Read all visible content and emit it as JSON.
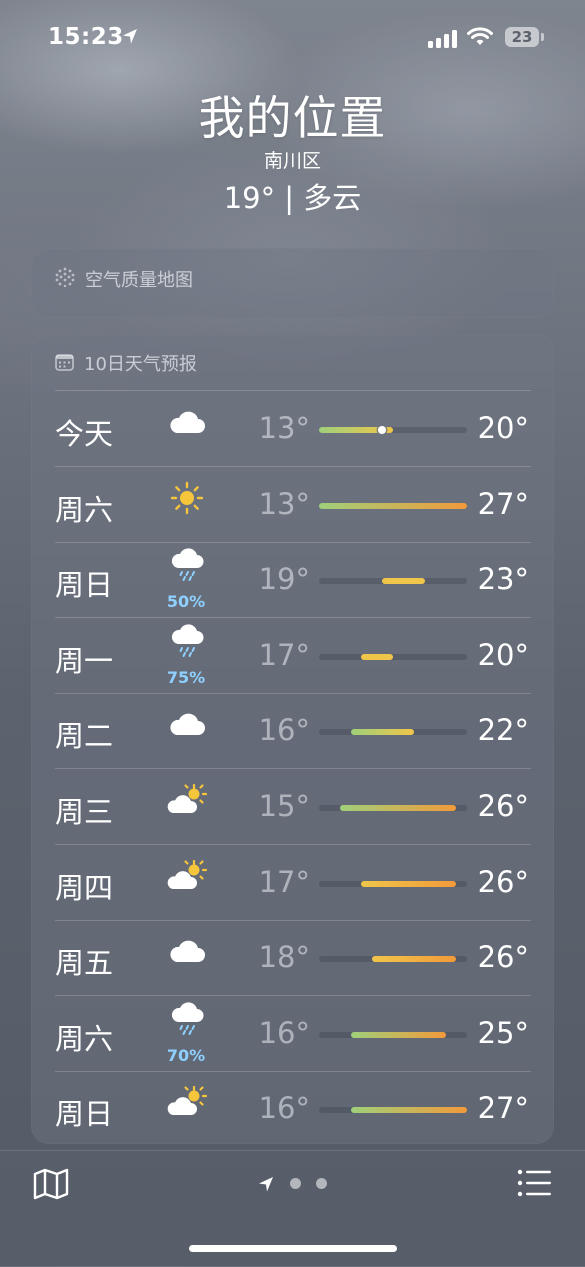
{
  "status_bar": {
    "time": "15:23",
    "battery": "23"
  },
  "header": {
    "location": "我的位置",
    "district": "南川区",
    "current": "19° | 多云"
  },
  "air_quality": {
    "icon": "air-quality-dots-icon",
    "label": "空气质量地图"
  },
  "forecast": {
    "icon": "calendar-icon",
    "title": "10日天气预报",
    "range_min": 13,
    "range_max": 27,
    "current_temp": 19,
    "days": [
      {
        "day": "今天",
        "icon": "cloud-icon",
        "precip": "",
        "low": "13°",
        "high": "20°",
        "low_val": 13,
        "high_val": 20,
        "show_current": true
      },
      {
        "day": "周六",
        "icon": "sun-icon",
        "precip": "",
        "low": "13°",
        "high": "27°",
        "low_val": 13,
        "high_val": 27,
        "show_current": false
      },
      {
        "day": "周日",
        "icon": "cloud-rain-icon",
        "precip": "50%",
        "low": "19°",
        "high": "23°",
        "low_val": 19,
        "high_val": 23,
        "show_current": false
      },
      {
        "day": "周一",
        "icon": "cloud-rain-icon",
        "precip": "75%",
        "low": "17°",
        "high": "20°",
        "low_val": 17,
        "high_val": 20,
        "show_current": false
      },
      {
        "day": "周二",
        "icon": "cloud-icon",
        "precip": "",
        "low": "16°",
        "high": "22°",
        "low_val": 16,
        "high_val": 22,
        "show_current": false
      },
      {
        "day": "周三",
        "icon": "partly-sunny-icon",
        "precip": "",
        "low": "15°",
        "high": "26°",
        "low_val": 15,
        "high_val": 26,
        "show_current": false
      },
      {
        "day": "周四",
        "icon": "partly-sunny-icon",
        "precip": "",
        "low": "17°",
        "high": "26°",
        "low_val": 17,
        "high_val": 26,
        "show_current": false
      },
      {
        "day": "周五",
        "icon": "cloud-icon",
        "precip": "",
        "low": "18°",
        "high": "26°",
        "low_val": 18,
        "high_val": 26,
        "show_current": false
      },
      {
        "day": "周六",
        "icon": "cloud-rain-icon",
        "precip": "70%",
        "low": "16°",
        "high": "25°",
        "low_val": 16,
        "high_val": 25,
        "show_current": false
      },
      {
        "day": "周日",
        "icon": "partly-sunny-icon",
        "precip": "",
        "low": "16°",
        "high": "27°",
        "low_val": 16,
        "high_val": 27,
        "show_current": false
      }
    ]
  },
  "bottom_bar": {
    "map_icon": "map-icon",
    "list_icon": "list-icon",
    "location_page_icon": "location-arrow-icon",
    "page_count": 3,
    "current_page": 0
  },
  "colors": {
    "cool": "#9fd07a",
    "warm": "#f0c64a",
    "hot": "#f29a3a",
    "precip": "#8fd0ff"
  }
}
